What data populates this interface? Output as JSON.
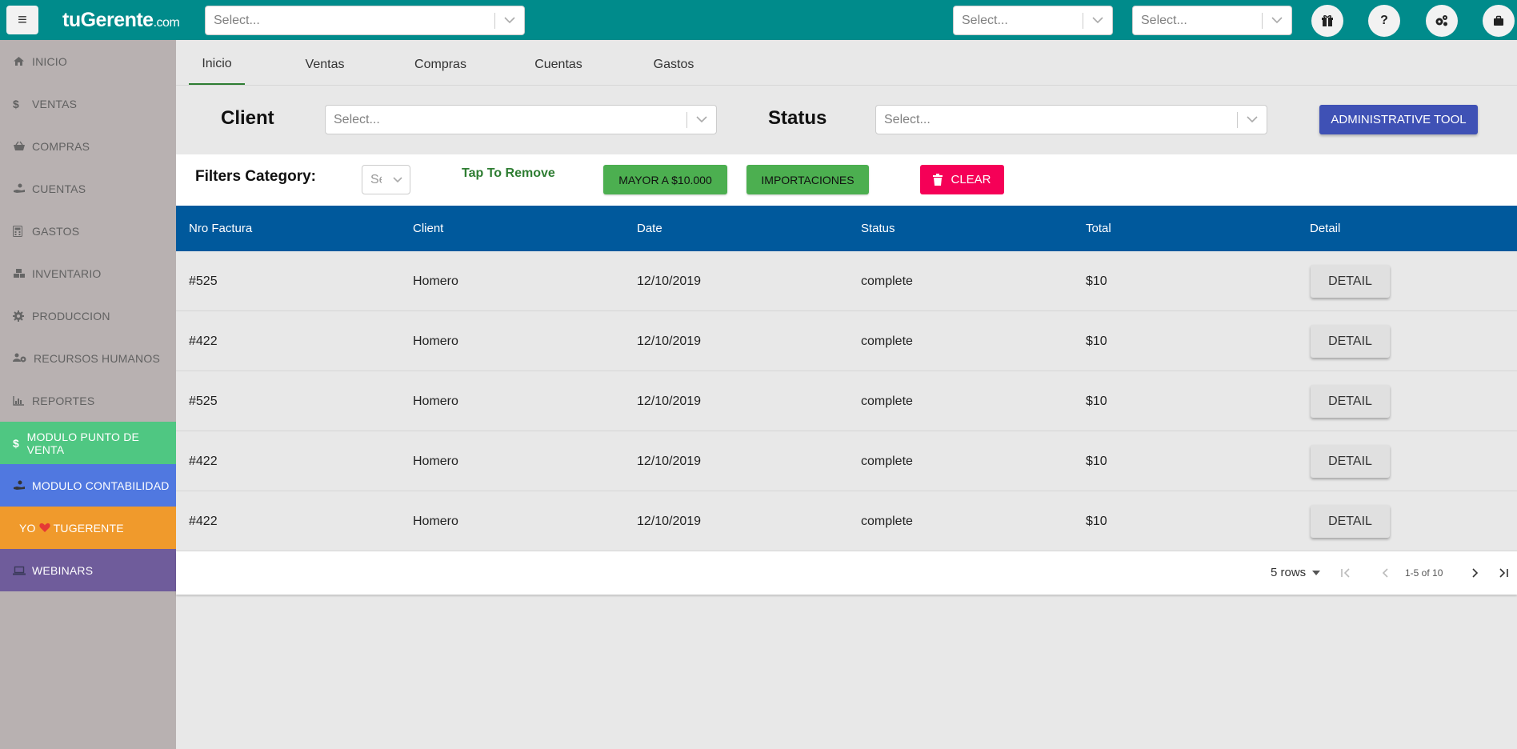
{
  "topbar": {
    "logo_main": "tuGerente",
    "logo_suffix": ".com",
    "select_main_placeholder": "Select...",
    "select_right1_placeholder": "Select...",
    "select_right2_placeholder": "Select...",
    "buttons": [
      "gift-icon",
      "question-icon",
      "gears-icon",
      "briefcase-icon"
    ],
    "help_label": "?"
  },
  "sidebar": {
    "items": [
      {
        "label": "INICIO",
        "icon": "home-icon"
      },
      {
        "label": "VENTAS",
        "icon": "dollar-icon"
      },
      {
        "label": "COMPRAS",
        "icon": "basket-icon"
      },
      {
        "label": "CUENTAS",
        "icon": "hand-coin-icon"
      },
      {
        "label": "GASTOS",
        "icon": "calculator-icon"
      },
      {
        "label": "INVENTARIO",
        "icon": "boxes-icon"
      },
      {
        "label": "PRODUCCION",
        "icon": "gear-icon"
      },
      {
        "label": "RECURSOS HUMANOS",
        "icon": "users-gear-icon"
      },
      {
        "label": "REPORTES",
        "icon": "bar-chart-icon"
      }
    ],
    "modules": [
      {
        "label": "MODULO PUNTO DE VENTA",
        "icon": "dollar-icon",
        "color": "#4fc782"
      },
      {
        "label": "MODULO CONTABILIDAD",
        "icon": "hand-coin-icon",
        "color": "#5078e0"
      },
      {
        "label_prefix": "YO",
        "label_suffix": "TUGERENTE",
        "icon": "heart-icon",
        "color": "#f09a2c"
      },
      {
        "label": "WEBINARS",
        "icon": "laptop-icon",
        "color": "#6f5c9b"
      }
    ]
  },
  "tabs": [
    "Inicio",
    "Ventas",
    "Compras",
    "Cuentas",
    "Gastos"
  ],
  "filters": {
    "client_label": "Client",
    "client_placeholder": "Select...",
    "status_label": "Status",
    "status_placeholder": "Select...",
    "admin_button": "ADMINISTRATIVE TOOL"
  },
  "category": {
    "label": "Filters Category:",
    "mini_placeholder": "Select...",
    "tap_hint": "Tap To Remove",
    "chips": [
      "MAYOR A $10.000",
      "IMPORTACIONES"
    ],
    "clear_label": "CLEAR"
  },
  "table": {
    "headers": [
      "Nro Factura",
      "Client",
      "Date",
      "Status",
      "Total",
      "Detail"
    ],
    "rows": [
      [
        "#525",
        "Homero",
        "12/10/2019",
        "complete",
        "$10",
        "DETAIL"
      ],
      [
        "#422",
        "Homero",
        "12/10/2019",
        "complete",
        "$10",
        "DETAIL"
      ],
      [
        "#525",
        "Homero",
        "12/10/2019",
        "complete",
        "$10",
        "DETAIL"
      ],
      [
        "#422",
        "Homero",
        "12/10/2019",
        "complete",
        "$10",
        "DETAIL"
      ],
      [
        "#422",
        "Homero",
        "12/10/2019",
        "complete",
        "$10",
        "DETAIL"
      ]
    ]
  },
  "pagination": {
    "rows_label": "5 rows",
    "range": "1-5 of 10"
  },
  "colors": {
    "topbar": "#008b8b",
    "sidebar": "#b8b1b1",
    "table_header": "#00599c",
    "admin_button": "#3f51b5",
    "chip": "#4caf50",
    "clear": "#f50057"
  }
}
